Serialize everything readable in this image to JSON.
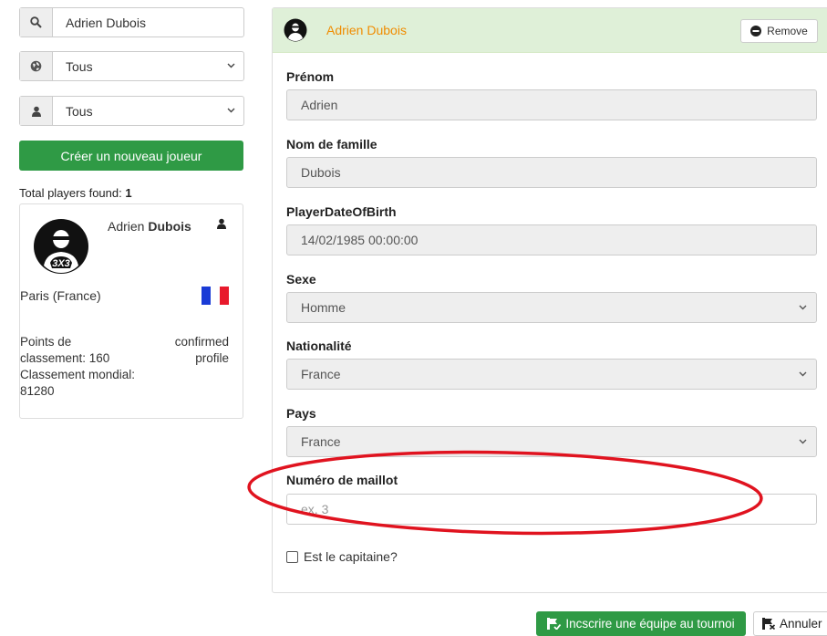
{
  "search": {
    "value": "Adrien Dubois"
  },
  "filter_country": {
    "value": "Tous"
  },
  "filter_gender": {
    "value": "Tous"
  },
  "create_button": {
    "label": "Créer un nouveau joueur"
  },
  "results": {
    "label": "Total players found:",
    "count": "1"
  },
  "player_card": {
    "first_name": "Adrien",
    "last_name": "Dubois",
    "location": "Paris (France)",
    "points": "Points de classement: 160",
    "ranking": "Classement mondial: 81280",
    "status": "confirmed profile",
    "avatar_logo": "3X3"
  },
  "panel": {
    "player_name": "Adrien Dubois",
    "remove_label": "Remove",
    "fields": {
      "first_name": {
        "label": "Prénom",
        "value": "Adrien"
      },
      "last_name": {
        "label": "Nom de famille",
        "value": "Dubois"
      },
      "dob": {
        "label": "PlayerDateOfBirth",
        "value": "14/02/1985 00:00:00"
      },
      "sex": {
        "label": "Sexe",
        "value": "Homme"
      },
      "nationality": {
        "label": "Nationalité",
        "value": "France"
      },
      "country": {
        "label": "Pays",
        "value": "France"
      },
      "jersey": {
        "label": "Numéro de maillot",
        "placeholder": "ex. 3"
      },
      "captain": {
        "label": "Est le capitaine?"
      }
    }
  },
  "footer": {
    "register_label": "Incscrire une équipe au tournoi",
    "cancel_label": "Annuler"
  },
  "colors": {
    "brand_green": "#2f9a45",
    "header_green": "#dff0d8",
    "accent_orange": "#f08c00",
    "annotation_red": "#e0131f",
    "flag_blue": "#1a3bd6",
    "flag_red": "#e8192c"
  },
  "icons": [
    "search-icon",
    "globe-icon",
    "user-icon",
    "chevron-down-icon",
    "minus-circle-icon",
    "register-icon",
    "cancel-icon"
  ]
}
